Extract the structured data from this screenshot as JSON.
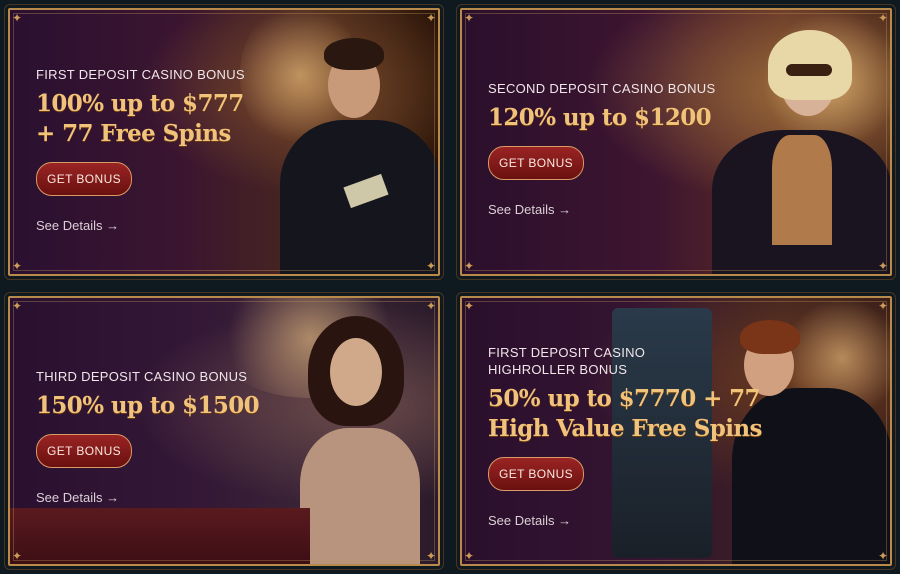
{
  "cards": [
    {
      "eyebrow": "FIRST DEPOSIT CASINO BONUS",
      "headline": "100% up to $777\n+ 77 Free Spins",
      "button_label": "GET BONUS",
      "details_label": "See Details →"
    },
    {
      "eyebrow": "SECOND DEPOSIT CASINO BONUS",
      "headline": "120% up to $1200",
      "button_label": "GET BONUS",
      "details_label": "See Details →"
    },
    {
      "eyebrow": "THIRD DEPOSIT CASINO BONUS",
      "headline": "150% up to $1500",
      "button_label": "GET BONUS",
      "details_label": "See Details →"
    },
    {
      "eyebrow": "FIRST DEPOSIT CASINO\nHIGHROLLER BONUS",
      "headline": "50% up to $7770 + 77\nHigh Value Free Spins",
      "button_label": "GET BONUS",
      "details_label": "See Details →"
    }
  ],
  "colors": {
    "accent_gold": "#f1c27a",
    "button_red": "#8a1a1a",
    "frame_gold": "#b98a4a",
    "background": "#0e1a20"
  }
}
